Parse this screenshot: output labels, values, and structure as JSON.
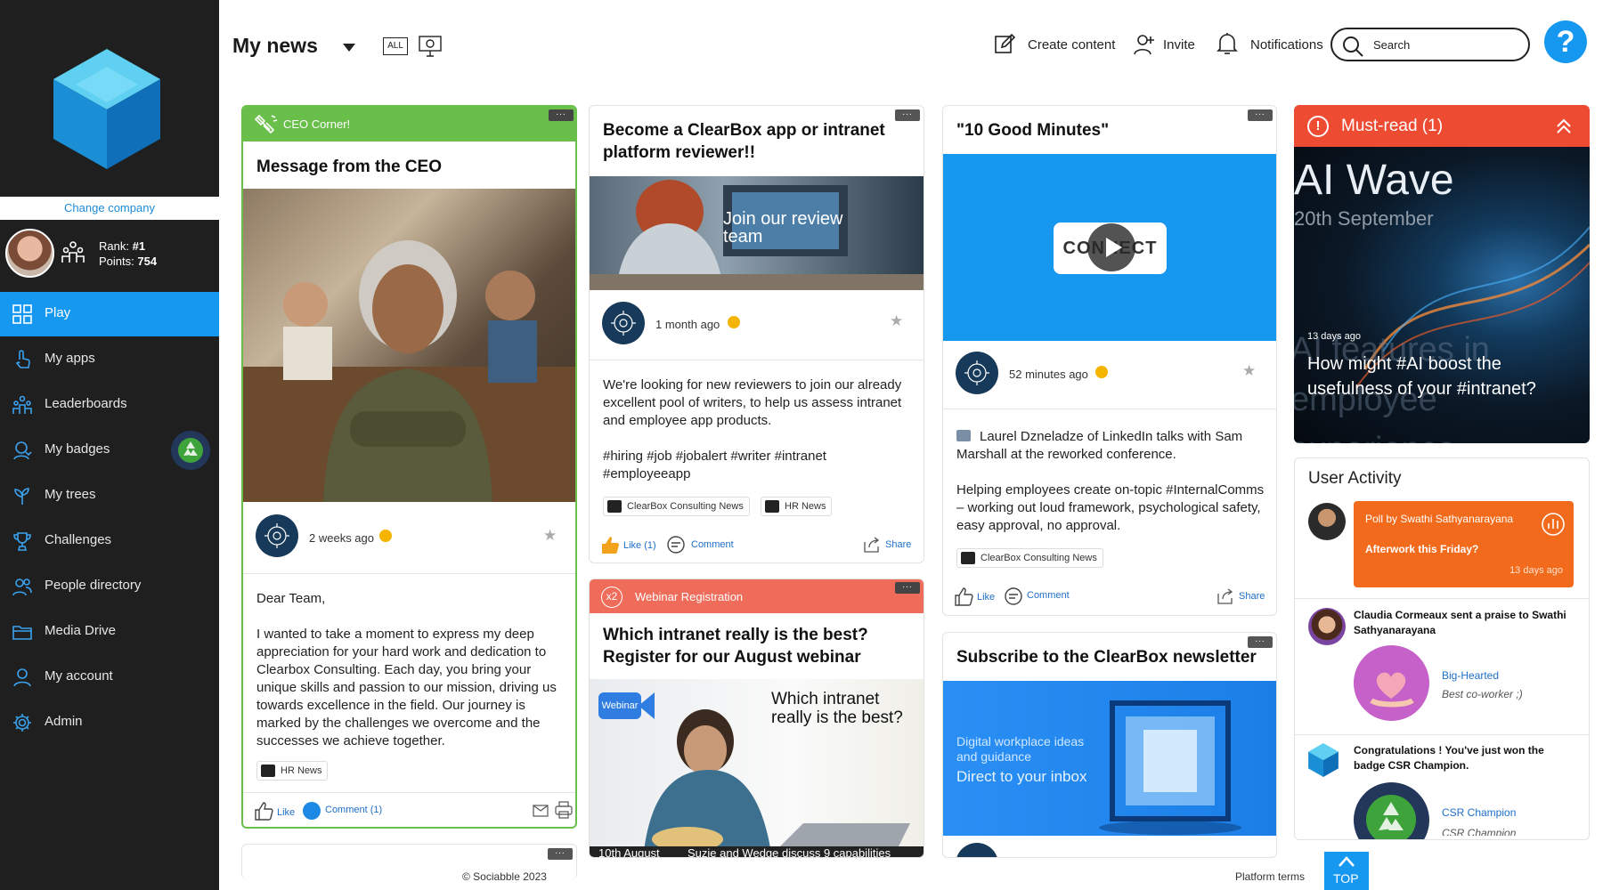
{
  "sidebar": {
    "change_company": "Change company",
    "rank_label": "Rank:",
    "rank_value": "#1",
    "points_label": "Points:",
    "points_value": "754",
    "items": [
      {
        "label": "Play",
        "icon": "grid-icon"
      },
      {
        "label": "My apps",
        "icon": "hand-pointer-icon"
      },
      {
        "label": "Leaderboards",
        "icon": "people-chart-icon"
      },
      {
        "label": "My badges",
        "icon": "badge-person-icon"
      },
      {
        "label": "My trees",
        "icon": "tree-icon"
      },
      {
        "label": "Challenges",
        "icon": "trophy-icon"
      },
      {
        "label": "People directory",
        "icon": "people-icon"
      },
      {
        "label": "Media Drive",
        "icon": "folder-icon"
      },
      {
        "label": "My account",
        "icon": "person-icon"
      },
      {
        "label": "Admin",
        "icon": "gear-icon"
      }
    ]
  },
  "header": {
    "title": "My news",
    "filter_all": "ALL",
    "create_content": "Create content",
    "invite": "Invite",
    "notifications": "Notifications",
    "search_placeholder": "Search",
    "help": "?"
  },
  "ceo_card": {
    "banner": "CEO Corner!",
    "title": "Message from the CEO",
    "time": "2 weeks ago",
    "greeting": "Dear Team,",
    "body": "I wanted to take a moment to express my deep appreciation for your hard work and dedication to Clearbox Consulting. Each day, you bring your unique skills and passion to our mission, driving us towards excellence in the field. Our journey is marked by the challenges we overcome and the successes we achieve together.",
    "tag": "HR News",
    "like": "Like",
    "comment": "Comment (1)"
  },
  "reviewer_card": {
    "title": "Become a ClearBox app or intranet platform reviewer!!",
    "image_text": "Join our review team",
    "time": "1 month ago",
    "body": "We're looking for new reviewers to join our already excellent pool of writers, to help us assess intranet and employee app products.",
    "hashtags": "#hiring #job #jobalert #writer #intranet #employeeapp",
    "tags": [
      "ClearBox Consulting News",
      "HR News"
    ],
    "like": "Like",
    "like_count": "(1)",
    "comment": "Comment",
    "share": "Share"
  },
  "webinar_card": {
    "banner_badge": "x2",
    "banner": "Webinar Registration",
    "title": "Which intranet really is the best? Register for our August webinar",
    "image_badge": "Webinar",
    "image_text": "Which intranet really is the best?",
    "footer_left": "10th August",
    "footer_right": "Suzie and Wedge discuss 9 capabilities"
  },
  "good_minutes_card": {
    "title": "\"10 Good Minutes\"",
    "video_label": "CONNECT",
    "time": "52 minutes ago",
    "body1": "Laurel Dzneladze of LinkedIn talks with Sam Marshall at the reworked conference.",
    "body2": "Helping employees create on-topic #InternalComms – working out loud framework, psychological safety, easy approval, no approval.",
    "tag": "ClearBox Consulting News",
    "like": "Like",
    "comment": "Comment",
    "share": "Share"
  },
  "newsletter_card": {
    "title": "Subscribe to the ClearBox newsletter",
    "image_line1": "Digital workplace ideas",
    "image_line2": "and guidance",
    "image_line3": "Direct to your inbox"
  },
  "must_read": {
    "title": "Must-read (1)",
    "image_big": "AI Wave",
    "image_date": "20th September",
    "bg_text": "AI features in employee experience platforms",
    "time": "13 days ago",
    "headline": "How might #AI boost the usefulness of your #intranet?"
  },
  "user_activity": {
    "title": "User Activity",
    "poll_title": "Poll by Swathi Sathyanarayana",
    "poll_question": "Afterwork this Friday?",
    "poll_time": "13 days ago",
    "praise_text": "Claudia Cormeaux sent a praise to Swathi Sathyanarayana",
    "praise_name": "Big-Hearted",
    "praise_note": "Best co-worker ;)",
    "badge_text": "Congratulations ! You've just won the badge CSR Champion.",
    "badge_name": "CSR Champion",
    "badge_sub": "CSR Champion"
  },
  "footer": {
    "copyright": "© Sociabble 2023",
    "terms": "Platform terms",
    "top": "TOP"
  },
  "colors": {
    "accent": "#1798f0",
    "sidebar_bg": "#1f1f1f",
    "ceo_green": "#6abf4b",
    "webinar_red": "#ef6b5a",
    "must_read_red": "#ee4b33",
    "poll_orange": "#f26a1b"
  }
}
